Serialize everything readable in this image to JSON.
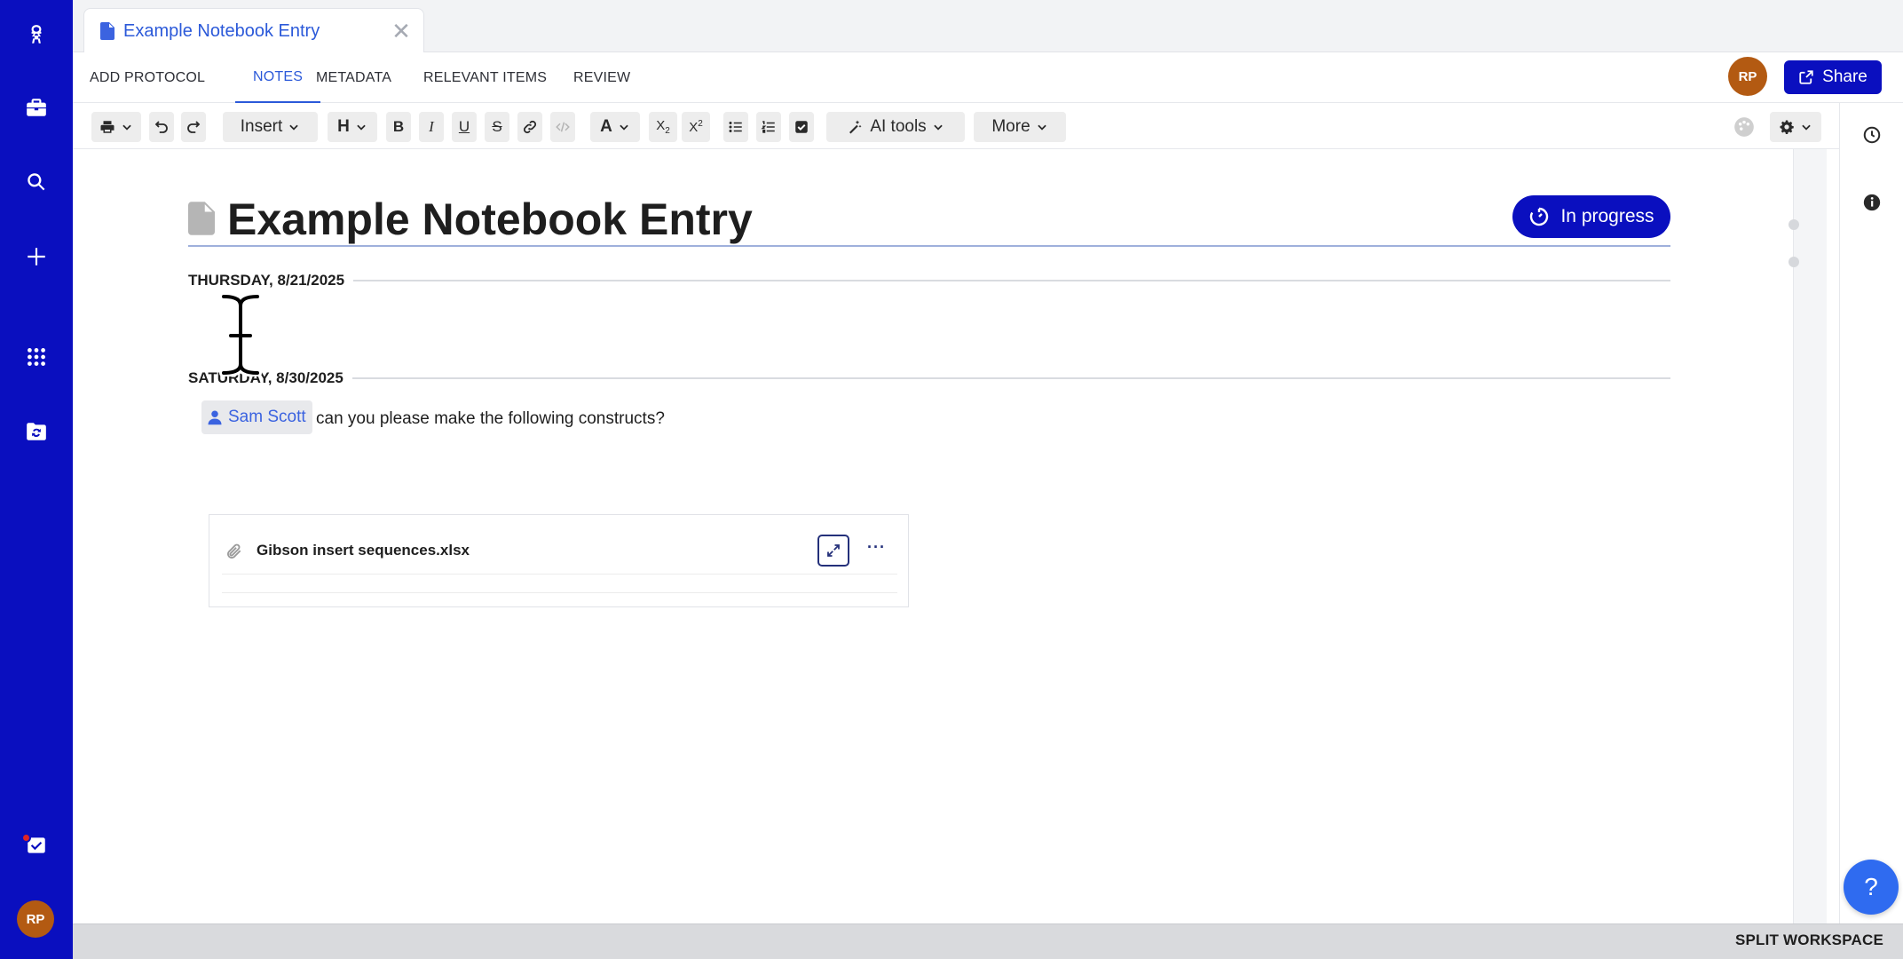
{
  "window": {
    "tab_title": "Example Notebook Entry"
  },
  "sidebar": {
    "items": [
      {
        "icon": "app-logo-icon"
      },
      {
        "icon": "briefcase-icon"
      },
      {
        "icon": "search-icon"
      },
      {
        "icon": "plus-icon"
      },
      {
        "icon": "apps-grid-icon"
      },
      {
        "icon": "sync-folder-icon"
      },
      {
        "icon": "tasks-icon"
      }
    ],
    "avatar_initials": "RP"
  },
  "section_tabs": [
    {
      "label": "ADD PROTOCOL"
    },
    {
      "label": "NOTES",
      "active": true
    },
    {
      "label": "METADATA"
    },
    {
      "label": "RELEVANT ITEMS"
    },
    {
      "label": "REVIEW"
    }
  ],
  "header": {
    "user_initials": "RP",
    "share_label": "Share"
  },
  "toolbar": {
    "insert_label": "Insert",
    "heading_label": "H",
    "font_color_label": "A",
    "ai_tools_label": "AI tools",
    "more_label": "More"
  },
  "entry": {
    "title": "Example Notebook Entry",
    "status": "In progress",
    "dates": [
      {
        "label": "THURSDAY, 8/21/2025"
      },
      {
        "label": "SATURDAY, 8/30/2025"
      }
    ],
    "mention": "Sam Scott",
    "note_text": "can you please make the following constructs?",
    "attachment": {
      "file_name": "Gibson insert sequences.xlsx",
      "more_label": "···"
    }
  },
  "footer": {
    "split_workspace_label": "SPLIT WORKSPACE"
  },
  "help_label": "?",
  "colors": {
    "rail": "#0a0fbf",
    "accent": "#2b59d9",
    "avatar": "#b35a12"
  }
}
